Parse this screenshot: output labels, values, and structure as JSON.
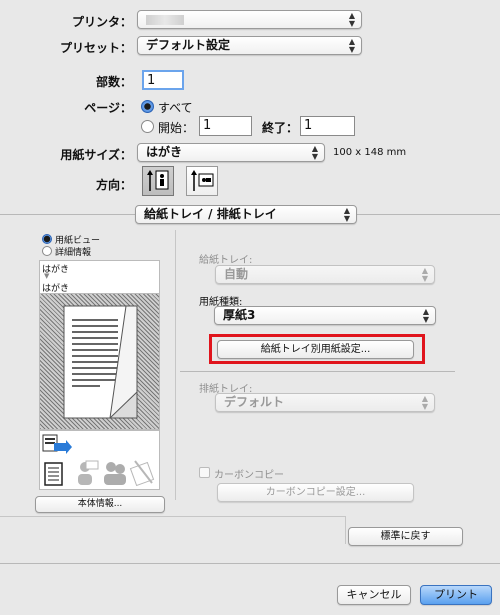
{
  "printer": {
    "label": "プリンタ：",
    "value": ""
  },
  "preset": {
    "label": "プリセット：",
    "value": "デフォルト設定"
  },
  "copies": {
    "label": "部数：",
    "value": "1"
  },
  "pages": {
    "label": "ページ：",
    "all_label": "すべて",
    "from_label": "開始：",
    "from_value": "1",
    "to_label": "終了：",
    "to_value": "1"
  },
  "paper_size": {
    "label": "用紙サイズ：",
    "value": "はがき",
    "dims": "100 x 148 mm"
  },
  "orientation": {
    "label": "方向："
  },
  "section": {
    "value": "給紙トレイ / 排紙トレイ"
  },
  "preview": {
    "radio_paper_view": "用紙ビュー",
    "radio_details": "詳細情報",
    "input_paper": "はがき",
    "arrow": "▼",
    "output_paper": "はがき",
    "device_info_button": "本体情報..."
  },
  "tray": {
    "input_tray_label": "給紙トレイ:",
    "input_tray_value": "自動",
    "paper_type_label": "用紙種類:",
    "paper_type_value": "厚紙3",
    "per_tray_button": "給紙トレイ別用紙設定...",
    "output_tray_label": "排紙トレイ:",
    "output_tray_value": "デフォルト",
    "carbon_copy_label": "カーボンコピー",
    "carbon_copy_settings_button": "カーボンコピー設定..."
  },
  "restore_defaults_button": "標準に戻す",
  "cancel_button": "キャンセル",
  "print_button": "プリント",
  "colors": {
    "highlight_box": "#e0141c",
    "accent": "#3d7fd6"
  }
}
